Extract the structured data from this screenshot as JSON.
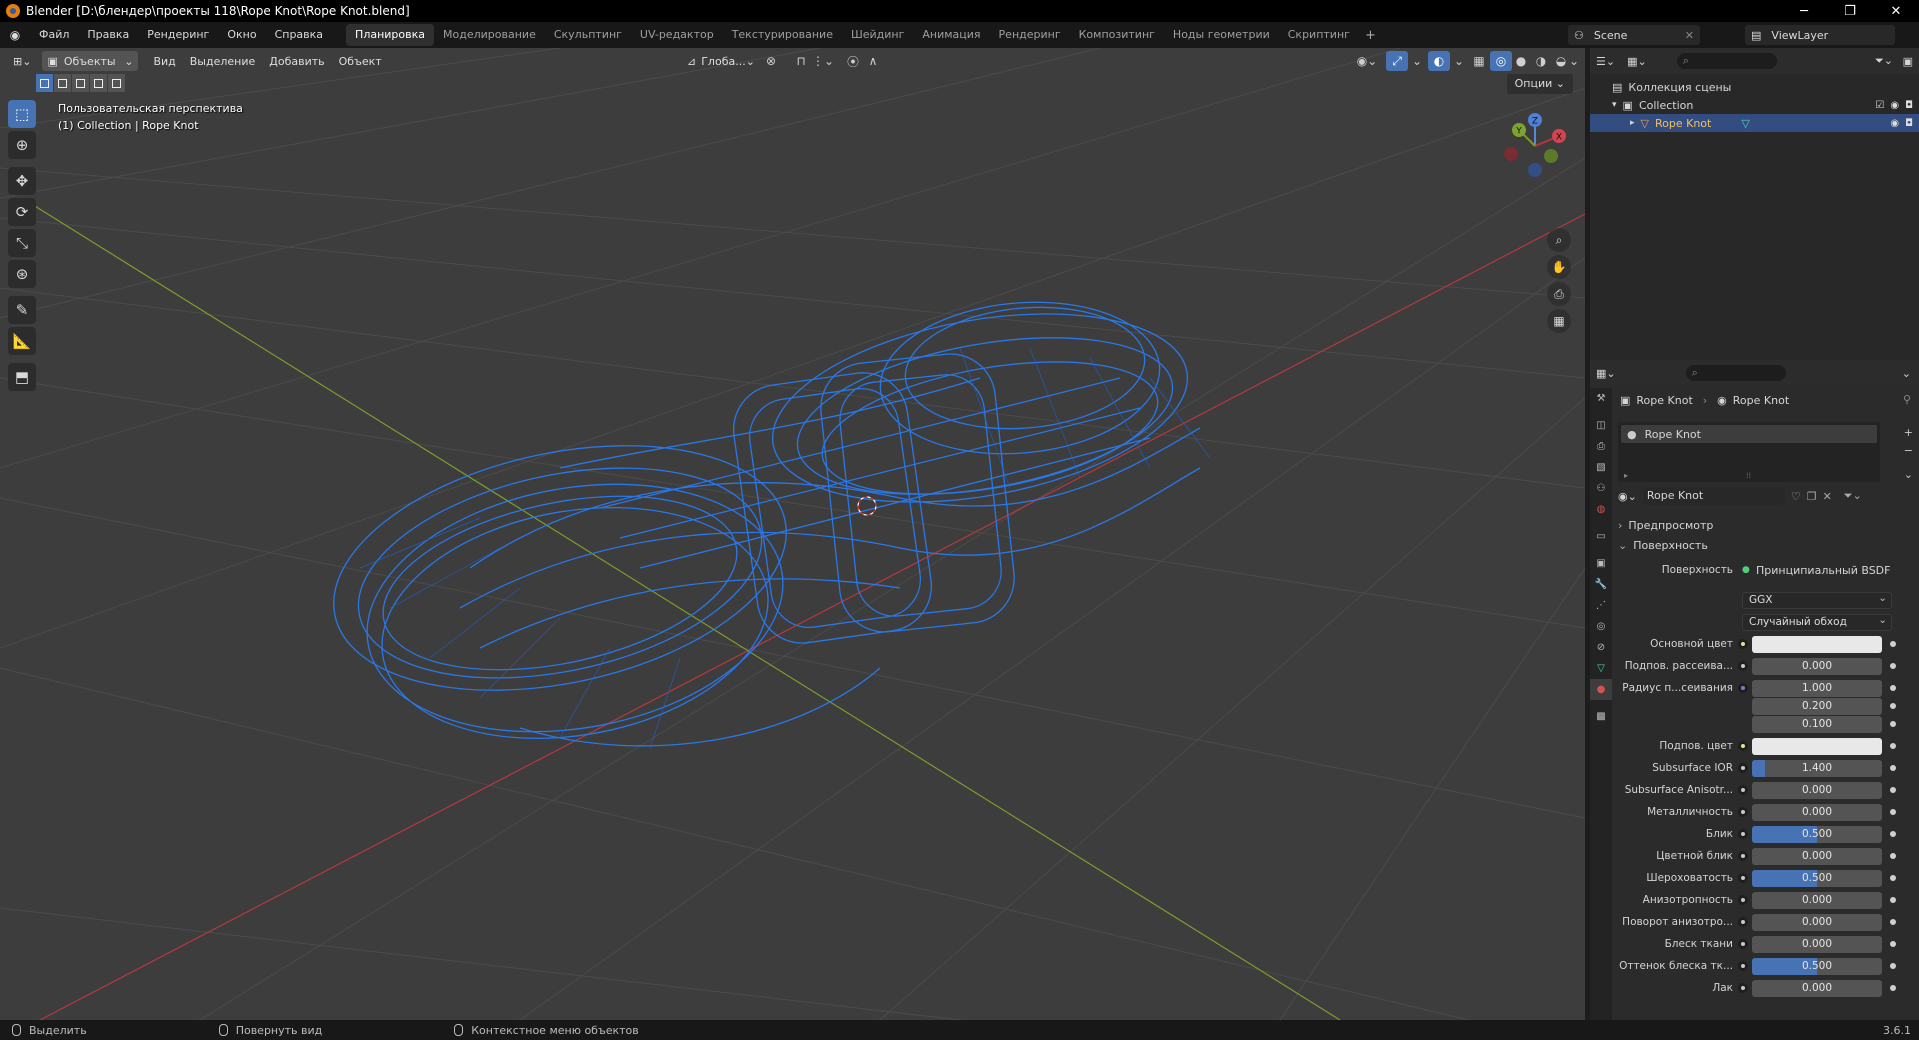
{
  "window": {
    "title": "Blender [D:\\блендер\\проекты 118\\Rope Knot\\Rope Knot.blend]",
    "controls": [
      "─",
      "❐",
      "✕"
    ]
  },
  "menubar": {
    "menus": [
      "Файл",
      "Правка",
      "Рендеринг",
      "Окно",
      "Справка"
    ],
    "workspaces": [
      "Планировка",
      "Моделирование",
      "Скульптинг",
      "UV-редактор",
      "Текстурирование",
      "Шейдинг",
      "Анимация",
      "Рендеринг",
      "Композитинг",
      "Ноды геометрии",
      "Скриптинг"
    ],
    "active_workspace": "Планировка",
    "add_label": "+",
    "scene": "Scene",
    "view_layer": "ViewLayer"
  },
  "viewport": {
    "mode": "Объекты",
    "menus": [
      "Вид",
      "Выделение",
      "Добавить",
      "Объект"
    ],
    "transform_orientation": "Глоба...",
    "options_label": "Опции",
    "info_line1": "Пользовательская перспектива",
    "info_line2": "(1) Collection | Rope Knot",
    "gizmo": {
      "x": "X",
      "y": "Y",
      "z": "Z"
    }
  },
  "outliner": {
    "search_placeholder": "",
    "rows": [
      {
        "label": "Коллекция сцены"
      },
      {
        "label": "Collection"
      },
      {
        "label": "Rope Knot"
      }
    ]
  },
  "properties": {
    "breadcrumb_object": "Rope Knot",
    "breadcrumb_material": "Rope Knot",
    "slot_name": "Rope Knot",
    "material_name": "Rope Knot",
    "panel_preview": "Предпросмотр",
    "panel_surface": "Поверхность",
    "surface_label": "Поверхность",
    "surface_value": "Принципиальный BSDF",
    "distribution": "GGX",
    "subsurface_method": "Случайный обход",
    "rows": [
      {
        "label": "Основной цвет",
        "type": "color",
        "color": "#e8e8e8",
        "dot": "yellow"
      },
      {
        "label": "Подпов. рассеива...",
        "type": "value",
        "value": "0.000",
        "fill": 0,
        "dot": "grey"
      },
      {
        "label": "Радиус п...сеивания",
        "type": "value",
        "value": "1.000",
        "fill": 0,
        "dot": "blue"
      },
      {
        "label": "",
        "type": "value",
        "value": "0.200",
        "fill": 0,
        "dot": "none"
      },
      {
        "label": "",
        "type": "value",
        "value": "0.100",
        "fill": 0,
        "dot": "none"
      },
      {
        "label": "Подпов. цвет",
        "type": "color",
        "color": "#e8e8e8",
        "dot": "yellow"
      },
      {
        "label": "Subsurface IOR",
        "type": "value",
        "value": "1.400",
        "fill": 0.1,
        "dot": "grey"
      },
      {
        "label": "Subsurface Anisotr...",
        "type": "value",
        "value": "0.000",
        "fill": 0,
        "dot": "grey"
      },
      {
        "label": "Металличность",
        "type": "value",
        "value": "0.000",
        "fill": 0,
        "dot": "grey"
      },
      {
        "label": "Блик",
        "type": "value",
        "value": "0.500",
        "fill": 0.5,
        "dot": "grey"
      },
      {
        "label": "Цветной блик",
        "type": "value",
        "value": "0.000",
        "fill": 0,
        "dot": "grey"
      },
      {
        "label": "Шероховатость",
        "type": "value",
        "value": "0.500",
        "fill": 0.5,
        "dot": "grey"
      },
      {
        "label": "Анизотропность",
        "type": "value",
        "value": "0.000",
        "fill": 0,
        "dot": "grey"
      },
      {
        "label": "Поворот анизотро...",
        "type": "value",
        "value": "0.000",
        "fill": 0,
        "dot": "grey"
      },
      {
        "label": "Блеск ткани",
        "type": "value",
        "value": "0.000",
        "fill": 0,
        "dot": "grey"
      },
      {
        "label": "Оттенок блеска тк...",
        "type": "value",
        "value": "0.500",
        "fill": 0.5,
        "dot": "grey"
      },
      {
        "label": "Лак",
        "type": "value",
        "value": "0.000",
        "fill": 0,
        "dot": "grey"
      }
    ]
  },
  "statusbar": {
    "items": [
      "Выделить",
      "Повернуть вид",
      "Контекстное меню объектов"
    ],
    "version": "3.6.1"
  },
  "colors": {
    "accent": "#4772b3",
    "wireframe": "#2a7bf0",
    "axis_x": "#b3393f",
    "axis_y": "#7d9c2c"
  }
}
